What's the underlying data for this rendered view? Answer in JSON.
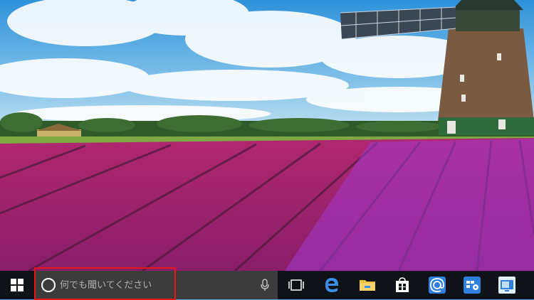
{
  "taskbar": {
    "search": {
      "placeholder": "何でも聞いてください"
    },
    "icons": [
      {
        "name": "task-view-icon"
      },
      {
        "name": "edge-icon"
      },
      {
        "name": "file-explorer-icon"
      },
      {
        "name": "store-icon"
      },
      {
        "name": "mail-icon"
      },
      {
        "name": "settings-app-icon"
      },
      {
        "name": "remote-desktop-icon"
      }
    ]
  },
  "colors": {
    "taskbar": "#0f1216",
    "search_box": "#3c3c3c",
    "highlight": "#e81515",
    "accent": "#3b8ee8"
  }
}
